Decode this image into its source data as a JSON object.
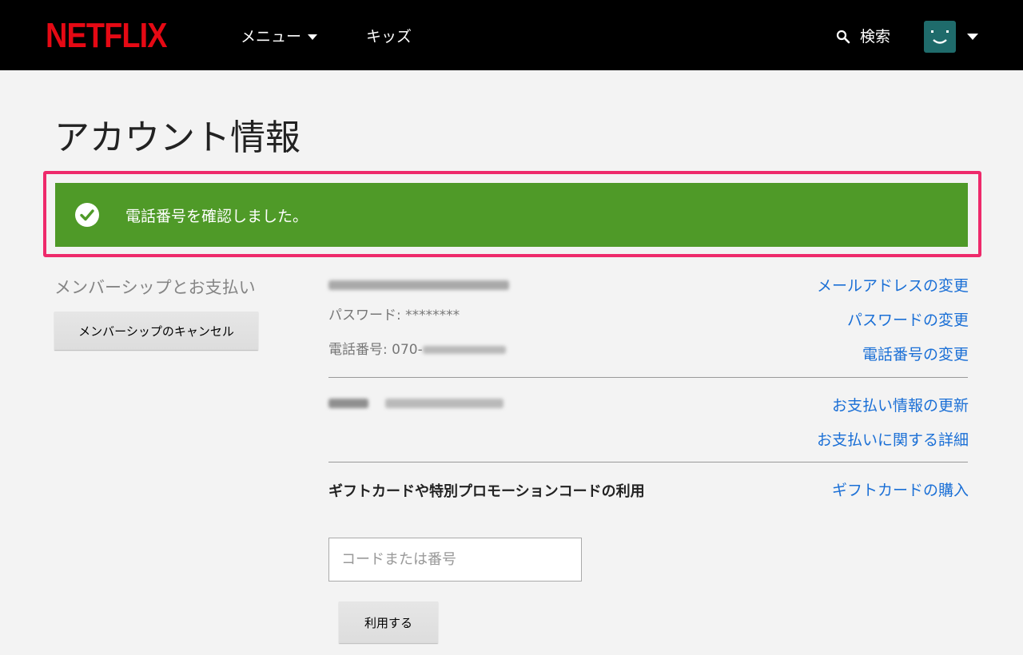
{
  "header": {
    "logo": "NETFLIX",
    "menu_label": "メニュー",
    "kids_label": "キッズ",
    "search_label": "検索"
  },
  "page": {
    "title": "アカウント情報"
  },
  "banner": {
    "message": "電話番号を確認しました。"
  },
  "membership": {
    "section_label": "メンバーシップとお支払い",
    "cancel_button": "メンバーシップのキャンセル",
    "password_text": "パスワード: ********",
    "phone_text": "電話番号: 070-",
    "links": {
      "change_email": "メールアドレスの変更",
      "change_password": "パスワードの変更",
      "change_phone": "電話番号の変更",
      "update_payment": "お支払い情報の更新",
      "payment_details": "お支払いに関する詳細"
    }
  },
  "gift": {
    "title": "ギフトカードや特別プロモーションコードの利用",
    "input_placeholder": "コードまたは番号",
    "submit_button": "利用する",
    "buy_link": "ギフトカードの購入"
  },
  "colors": {
    "brand_red": "#e50914",
    "success_green": "#4f9a28",
    "highlight_pink": "#ee2a6b",
    "link_blue": "#1a6fd6"
  }
}
